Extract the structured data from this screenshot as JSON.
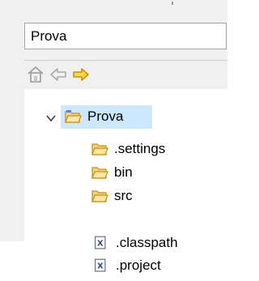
{
  "combo": {
    "value": "Prova"
  },
  "tree": {
    "project": {
      "label": "Prova",
      "icon": "open-project-folder-icon"
    },
    "children": [
      {
        "label": ".settings",
        "icon": "folder-icon"
      },
      {
        "label": "bin",
        "icon": "folder-icon"
      },
      {
        "label": "src",
        "icon": "folder-icon"
      },
      {
        "label": ".classpath",
        "icon": "xml-file-icon"
      },
      {
        "label": ".project",
        "icon": "xml-file-icon"
      }
    ]
  },
  "colors": {
    "selection": "#cce8ff",
    "folder": "#f2c35a",
    "forward_arrow": "#f5b800"
  }
}
